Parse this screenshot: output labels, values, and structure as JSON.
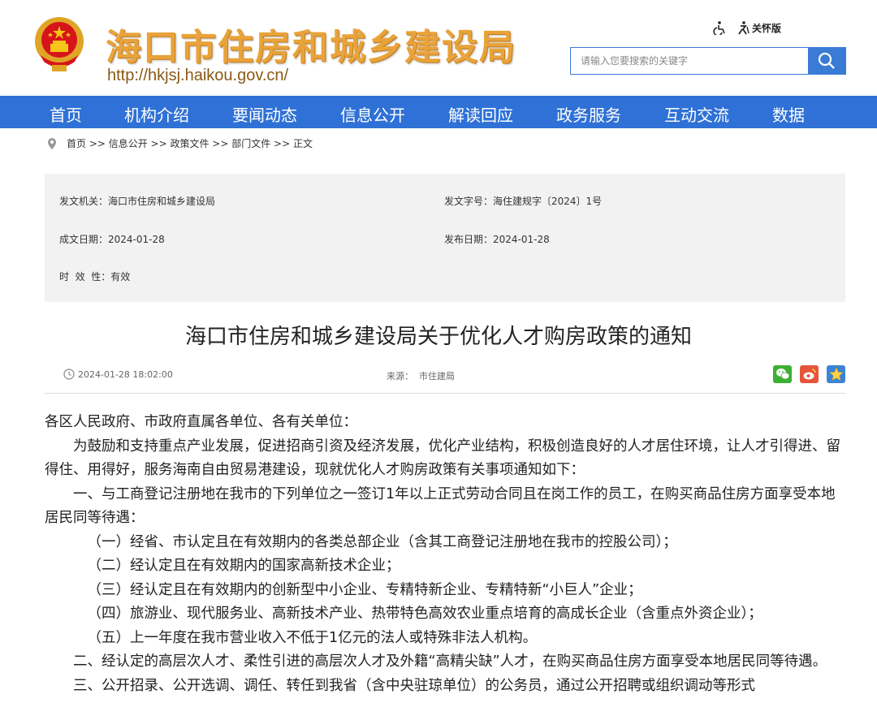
{
  "header": {
    "site_title": "海口市住房和城乡建设局",
    "site_url": "http://hkjsj.haikou.gov.cn/",
    "care_mode": "关怀版",
    "search_placeholder": "请输入您要搜索的关键字"
  },
  "nav": {
    "items": [
      "首页",
      "机构介绍",
      "要闻动态",
      "信息公开",
      "解读回应",
      "政务服务",
      "互动交流",
      "数据"
    ]
  },
  "breadcrumb": "首页 >> 信息公开 >> 政策文件 >> 部门文件 >> 正文",
  "meta": {
    "issuer": "发文机关：海口市住房和城乡建设局",
    "doc_no": "发文字号：海住建规字〔2024〕1号",
    "made_date": "成文日期：2024-01-28",
    "publish_date": "发布日期：2024-01-28",
    "validity": "时  效  性：有效"
  },
  "article": {
    "title": "海口市住房和城乡建设局关于优化人才购房政策的通知",
    "datetime": "2024-01-28 18:02:00",
    "source": "来源：  市住建局",
    "paragraphs": [
      "各区人民政府、市政府直属各单位、各有关单位：",
      "为鼓励和支持重点产业发展，促进招商引资及经济发展，优化产业结构，积极创造良好的人才居住环境，让人才引得进、留得住、用得好，服务海南自由贸易港建设，现就优化人才购房政策有关事项通知如下：",
      "一、与工商登记注册地在我市的下列单位之一签订1年以上正式劳动合同且在岗工作的员工，在购买商品住房方面享受本地居民同等待遇：",
      "（一）经省、市认定且在有效期内的各类总部企业（含其工商登记注册地在我市的控股公司）；",
      "（二）经认定且在有效期内的国家高新技术企业；",
      "（三）经认定且在有效期内的创新型中小企业、专精特新企业、专精特新“小巨人”企业；",
      "（四）旅游业、现代服务业、高新技术产业、热带特色高效农业重点培育的高成长企业（含重点外资企业）；",
      "（五）上一年度在我市营业收入不低于1亿元的法人或特殊非法人机构。",
      "二、经认定的高层次人才、柔性引进的高层次人才及外籍“高精尖缺”人才，在购买商品住房方面享受本地居民同等待遇。",
      "三、公开招录、公开选调、调任、转任到我省（含中央驻琼单位）的公务员，通过公开招聘或组织调动等形式"
    ]
  },
  "colors": {
    "brand_blue": "#2f71d6",
    "title_gold": "#e8a33a",
    "emblem_red": "#d7141a"
  }
}
